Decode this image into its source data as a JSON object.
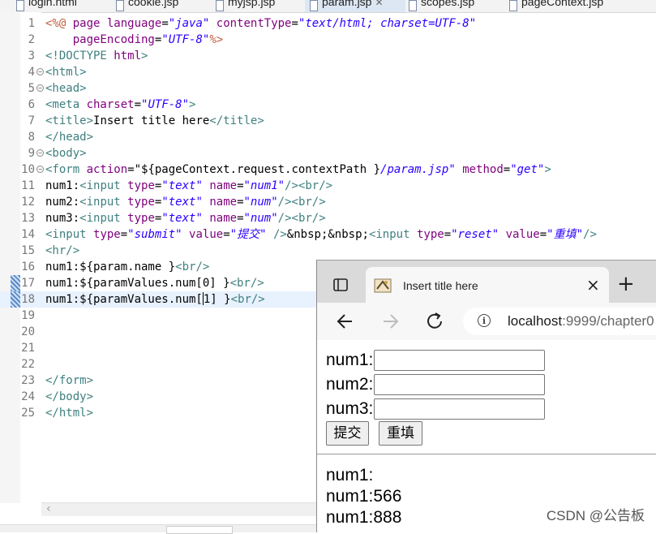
{
  "editor": {
    "tabs": [
      {
        "label": "login.html",
        "active": false
      },
      {
        "label": "cookie.jsp",
        "active": false
      },
      {
        "label": "myjsp.jsp",
        "active": false
      },
      {
        "label": "param.jsp",
        "active": true
      },
      {
        "label": "scopes.jsp",
        "active": false
      },
      {
        "label": "pageContext.jsp",
        "active": false
      }
    ],
    "lines": [
      {
        "n": "1",
        "fold": false,
        "tokens": [
          [
            "dl",
            "<%@ "
          ],
          [
            "an",
            "page "
          ],
          [
            "an",
            "language"
          ],
          [
            "t",
            "="
          ],
          [
            "av",
            "\"java\""
          ],
          [
            "t",
            " "
          ],
          [
            "an",
            "contentType"
          ],
          [
            "t",
            "="
          ],
          [
            "av",
            "\"text/html; charset=UTF-8\""
          ]
        ]
      },
      {
        "n": "2",
        "fold": false,
        "tokens": [
          [
            "t",
            "    "
          ],
          [
            "an",
            "pageEncoding"
          ],
          [
            "t",
            "="
          ],
          [
            "av",
            "\"UTF-8\""
          ],
          [
            "dl",
            "%>"
          ]
        ]
      },
      {
        "n": "3",
        "fold": false,
        "tokens": [
          [
            "tg",
            "<!DOCTYPE "
          ],
          [
            "an",
            "html"
          ],
          [
            "tg",
            ">"
          ]
        ]
      },
      {
        "n": "4",
        "fold": true,
        "tokens": [
          [
            "tg",
            "<html>"
          ]
        ]
      },
      {
        "n": "5",
        "fold": true,
        "tokens": [
          [
            "tg",
            "<head>"
          ]
        ]
      },
      {
        "n": "6",
        "fold": false,
        "tokens": [
          [
            "tg",
            "<meta "
          ],
          [
            "an",
            "charset"
          ],
          [
            "t",
            "="
          ],
          [
            "av",
            "\"UTF-8\""
          ],
          [
            "tg",
            ">"
          ]
        ]
      },
      {
        "n": "7",
        "fold": false,
        "tokens": [
          [
            "tg",
            "<title>"
          ],
          [
            "t",
            "Insert title here"
          ],
          [
            "tg",
            "</title>"
          ]
        ]
      },
      {
        "n": "8",
        "fold": false,
        "tokens": [
          [
            "tg",
            "</head>"
          ]
        ]
      },
      {
        "n": "9",
        "fold": true,
        "tokens": [
          [
            "tg",
            "<body>"
          ]
        ]
      },
      {
        "n": "10",
        "fold": true,
        "tokens": [
          [
            "tg",
            "<form "
          ],
          [
            "an",
            "action"
          ],
          [
            "t",
            "="
          ],
          [
            "t",
            "\"${pageContext.request.contextPath }"
          ],
          [
            "av",
            "/param.jsp\""
          ],
          [
            "t",
            " "
          ],
          [
            "an",
            "method"
          ],
          [
            "t",
            "="
          ],
          [
            "av",
            "\"get\""
          ],
          [
            "tg",
            ">"
          ]
        ]
      },
      {
        "n": "11",
        "fold": false,
        "tokens": [
          [
            "t",
            "num1:"
          ],
          [
            "tg",
            "<input "
          ],
          [
            "an",
            "type"
          ],
          [
            "t",
            "="
          ],
          [
            "av",
            "\"text\""
          ],
          [
            "t",
            " "
          ],
          [
            "an",
            "name"
          ],
          [
            "t",
            "="
          ],
          [
            "av",
            "\"num1\""
          ],
          [
            "tg",
            "/><br/>"
          ]
        ]
      },
      {
        "n": "12",
        "fold": false,
        "tokens": [
          [
            "t",
            "num2:"
          ],
          [
            "tg",
            "<input "
          ],
          [
            "an",
            "type"
          ],
          [
            "t",
            "="
          ],
          [
            "av",
            "\"text\""
          ],
          [
            "t",
            " "
          ],
          [
            "an",
            "name"
          ],
          [
            "t",
            "="
          ],
          [
            "av",
            "\"num\""
          ],
          [
            "tg",
            "/><br/>"
          ]
        ]
      },
      {
        "n": "13",
        "fold": false,
        "tokens": [
          [
            "t",
            "num3:"
          ],
          [
            "tg",
            "<input "
          ],
          [
            "an",
            "type"
          ],
          [
            "t",
            "="
          ],
          [
            "av",
            "\"text\""
          ],
          [
            "t",
            " "
          ],
          [
            "an",
            "name"
          ],
          [
            "t",
            "="
          ],
          [
            "av",
            "\"num\""
          ],
          [
            "tg",
            "/><br/>"
          ]
        ]
      },
      {
        "n": "14",
        "fold": false,
        "tokens": [
          [
            "tg",
            "<input "
          ],
          [
            "an",
            "type"
          ],
          [
            "t",
            "="
          ],
          [
            "av",
            "\"submit\""
          ],
          [
            "t",
            " "
          ],
          [
            "an",
            "value"
          ],
          [
            "t",
            "="
          ],
          [
            "av",
            "\"提交\""
          ],
          [
            "t",
            " "
          ],
          [
            "tg",
            "/>"
          ],
          [
            "t",
            "&nbsp;&nbsp;"
          ],
          [
            "tg",
            "<input "
          ],
          [
            "an",
            "type"
          ],
          [
            "t",
            "="
          ],
          [
            "av",
            "\"reset\""
          ],
          [
            "t",
            " "
          ],
          [
            "an",
            "value"
          ],
          [
            "t",
            "="
          ],
          [
            "av",
            "\"重填\""
          ],
          [
            "tg",
            "/>"
          ]
        ]
      },
      {
        "n": "15",
        "fold": false,
        "tokens": [
          [
            "tg",
            "<hr/>"
          ]
        ]
      },
      {
        "n": "16",
        "fold": false,
        "tokens": [
          [
            "t",
            "num1:${param.name }"
          ],
          [
            "tg",
            "<br/>"
          ]
        ]
      },
      {
        "n": "17",
        "fold": false,
        "marked": true,
        "tokens": [
          [
            "t",
            "num1:${paramValues.num[0] }"
          ],
          [
            "tg",
            "<br/>"
          ]
        ]
      },
      {
        "n": "18",
        "fold": false,
        "marked": true,
        "current": true,
        "tokens": [
          [
            "t",
            "num1:${paramValues.num["
          ],
          [
            "cursor",
            ""
          ],
          [
            "t",
            "1] }"
          ],
          [
            "tg",
            "<br/>"
          ]
        ]
      },
      {
        "n": "19",
        "fold": false,
        "tokens": []
      },
      {
        "n": "20",
        "fold": false,
        "tokens": []
      },
      {
        "n": "21",
        "fold": false,
        "tokens": []
      },
      {
        "n": "22",
        "fold": false,
        "tokens": []
      },
      {
        "n": "23",
        "fold": false,
        "tokens": [
          [
            "tg",
            "</form>"
          ]
        ]
      },
      {
        "n": "24",
        "fold": false,
        "tokens": [
          [
            "tg",
            "</body>"
          ]
        ]
      },
      {
        "n": "25",
        "fold": false,
        "tokens": [
          [
            "tg",
            "</html>"
          ]
        ]
      }
    ]
  },
  "browser": {
    "tab_title": "Insert title here",
    "tab_close": "×",
    "new_tab": "+",
    "url_host": "localhost",
    "url_rest": ":9999/chapter0",
    "form": {
      "fields": [
        {
          "label": "num1:",
          "value": ""
        },
        {
          "label": "num2:",
          "value": ""
        },
        {
          "label": "num3:",
          "value": ""
        }
      ],
      "submit_label": "提交",
      "reset_label": "重填"
    },
    "output": [
      "num1:",
      "num1:566",
      "num1:888"
    ]
  },
  "watermark": "CSDN @公告板"
}
